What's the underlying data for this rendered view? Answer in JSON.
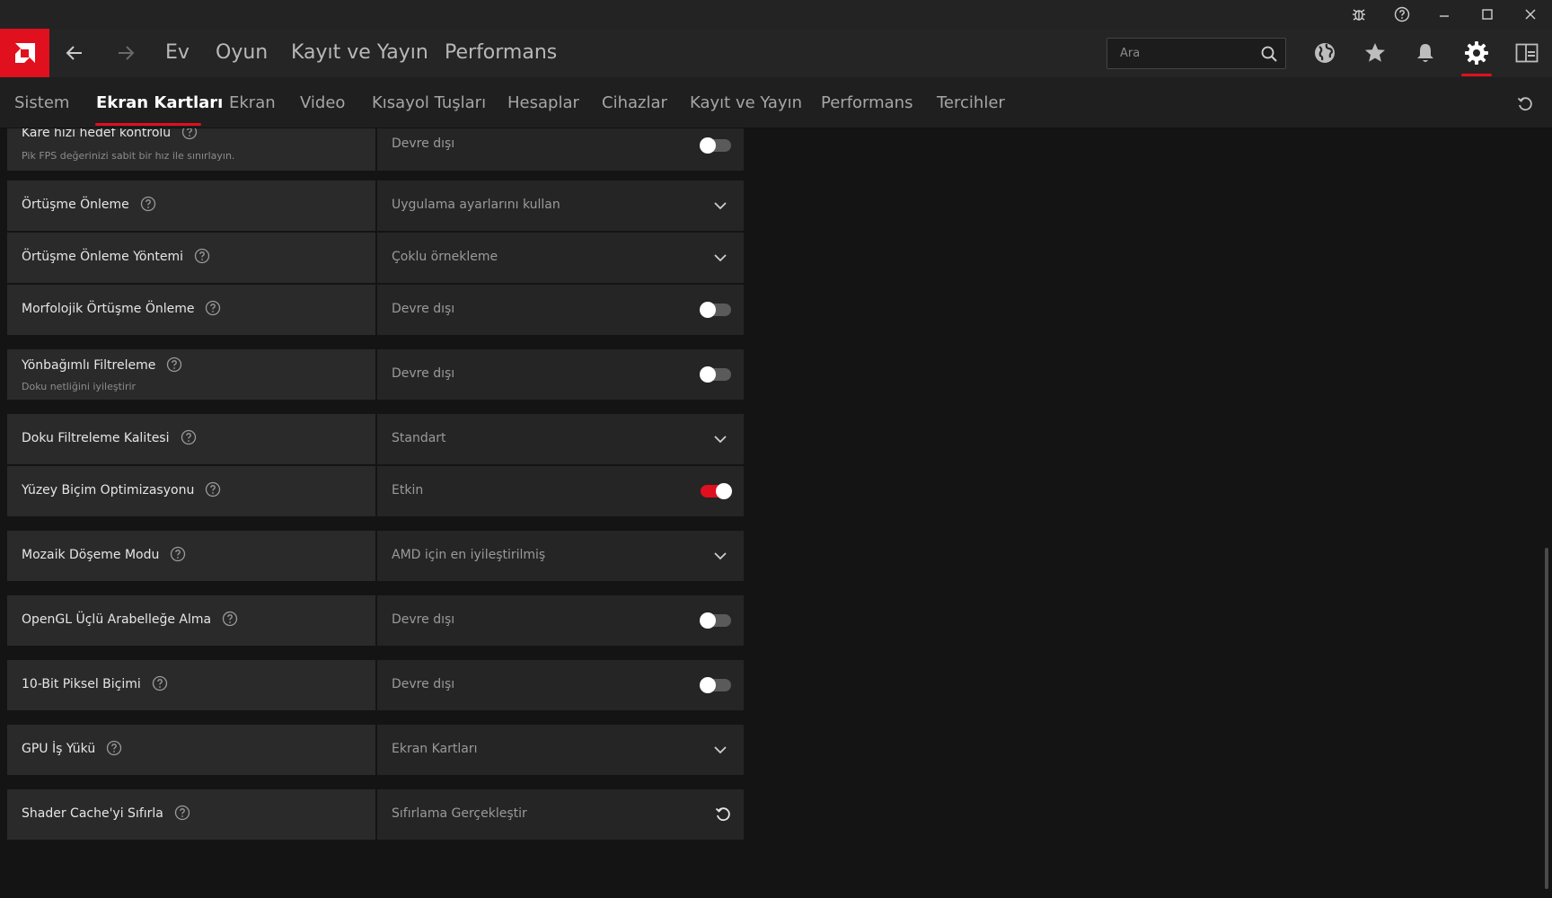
{
  "topnav": {
    "links": [
      "Ev",
      "Oyun",
      "Kayıt ve Yayın",
      "Performans"
    ],
    "search_placeholder": "Ara"
  },
  "subnav": {
    "tabs": [
      "Sistem",
      "Ekran Kartları",
      "Ekran",
      "Video",
      "Kısayol Tuşları",
      "Hesaplar",
      "Cihazlar",
      "Kayıt ve Yayın",
      "Performans",
      "Tercihler"
    ],
    "active": "Ekran Kartları"
  },
  "colors": {
    "accent": "#e0101e",
    "background": "#141414",
    "row_label_bg": "#2a2a2a",
    "row_value_bg": "#252525"
  },
  "icons": [
    "amd-logo-icon",
    "back-arrow-icon",
    "forward-arrow-icon",
    "bug-report-icon",
    "help-icon",
    "minimize-icon",
    "maximize-icon",
    "close-icon",
    "search-icon",
    "globe-icon",
    "star-icon",
    "bell-icon",
    "gear-icon",
    "sidebar-panel-icon",
    "reset-icon",
    "chevron-down-icon"
  ],
  "settings": [
    {
      "title": "Kare hızı hedef kontrolü",
      "subtitle": "Pik FPS değerinizi sabit bir hız ile sınırlayın.",
      "value": "Devre dışı",
      "control": "toggle",
      "on": false
    },
    {
      "title": "Örtüşme Önleme",
      "subtitle": "",
      "value": "Uygulama ayarlarını kullan",
      "control": "dropdown"
    },
    {
      "title": "Örtüşme Önleme Yöntemi",
      "subtitle": "",
      "value": "Çoklu örnekleme",
      "control": "dropdown"
    },
    {
      "title": "Morfolojik Örtüşme Önleme",
      "subtitle": "",
      "value": "Devre dışı",
      "control": "toggle",
      "on": false
    },
    {
      "title": "Yönbağımlı Filtreleme",
      "subtitle": "Doku netliğini iyileştirir",
      "value": "Devre dışı",
      "control": "toggle",
      "on": false
    },
    {
      "title": "Doku Filtreleme Kalitesi",
      "subtitle": "",
      "value": "Standart",
      "control": "dropdown"
    },
    {
      "title": "Yüzey Biçim Optimizasyonu",
      "subtitle": "",
      "value": "Etkin",
      "control": "toggle",
      "on": true
    },
    {
      "title": "Mozaik Döşeme Modu",
      "subtitle": "",
      "value": "AMD için en iyileştirilmiş",
      "control": "dropdown"
    },
    {
      "title": "OpenGL Üçlü Arabelleğe Alma",
      "subtitle": "",
      "value": "Devre dışı",
      "control": "toggle",
      "on": false
    },
    {
      "title": "10-Bit Piksel Biçimi",
      "subtitle": "",
      "value": "Devre dışı",
      "control": "toggle",
      "on": false
    },
    {
      "title": "GPU İş Yükü",
      "subtitle": "",
      "value": "Ekran Kartları",
      "control": "dropdown"
    },
    {
      "title": "Shader Cache'yi Sıfırla",
      "subtitle": "",
      "value": "Sıfırlama Gerçekleştir",
      "control": "reset"
    }
  ]
}
